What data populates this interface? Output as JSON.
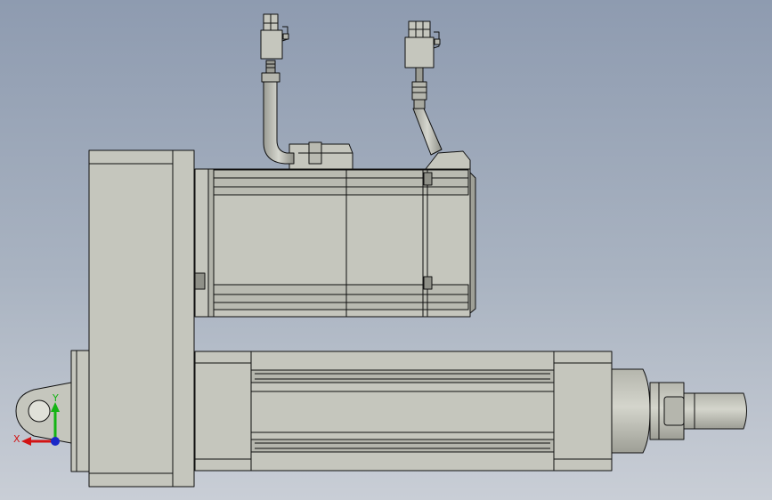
{
  "viewport": {
    "background_top": "#8e9bb0",
    "background_bottom": "#c9ced6"
  },
  "model": {
    "body_color": "#c5c6bd",
    "shade_color": "#a7a89f",
    "edge_color": "#101010",
    "parts": [
      "motor",
      "gearbox-housing",
      "actuator-tube",
      "rod-end-clevis",
      "piston-rod",
      "power-connector",
      "encoder-connector"
    ]
  },
  "triad": {
    "x_label": "X",
    "y_label": "Y",
    "x_color": "#d21414",
    "y_color": "#14b414",
    "z_color": "#1a28c8"
  }
}
